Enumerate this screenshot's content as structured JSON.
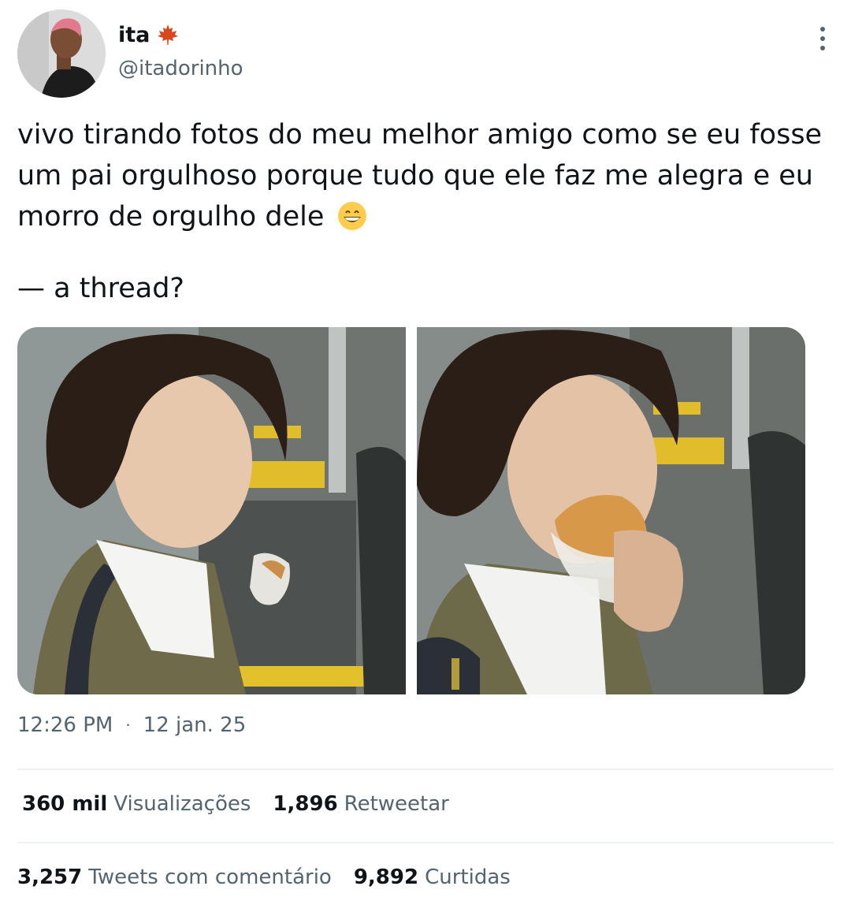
{
  "author": {
    "display_name": "ita",
    "handle": "@itadorinho",
    "badge_icon": "maple-leaf-icon"
  },
  "tweet": {
    "text": "vivo tirando fotos do meu melhor amigo como se eu fosse um pai orgulhoso porque tudo que ele faz me alegra e eu morro de orgulho dele",
    "emoji": "grinning-face-icon",
    "thread_line": "— a thread?",
    "time": "12:26 PM",
    "separator": "·",
    "date": "12 jan. 25"
  },
  "stats": {
    "views_count": "360 mil",
    "views_label": "Visualizações",
    "retweets_count": "1,896",
    "retweets_label": "Retweetar",
    "quotes_count": "3,257",
    "quotes_label": "Tweets com comentário",
    "likes_count": "9,892",
    "likes_label": "Curtidas"
  },
  "colors": {
    "text_primary": "#0f1419",
    "text_secondary": "#536471",
    "divider": "#eff3f4"
  }
}
